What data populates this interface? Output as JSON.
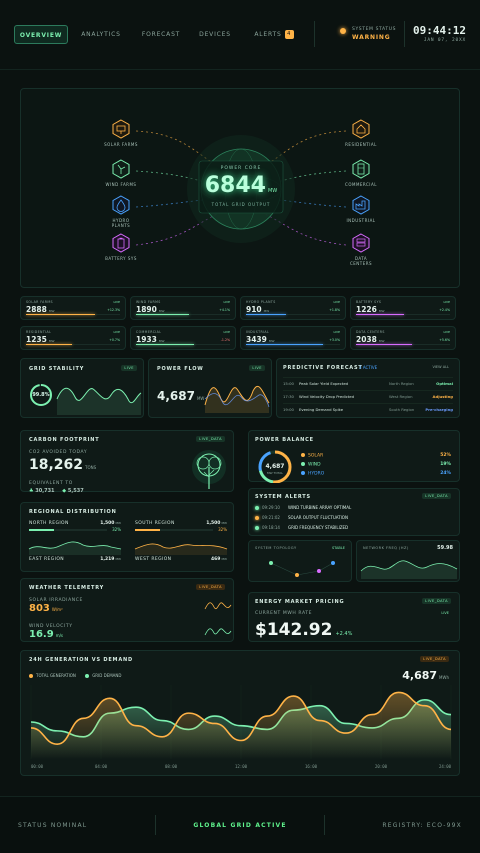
{
  "nav": {
    "tabs": [
      {
        "label": "Overview"
      },
      {
        "label": "Analytics"
      },
      {
        "label": "Forecast"
      },
      {
        "label": "Devices"
      },
      {
        "label": "Alerts"
      }
    ],
    "alerts_count": "4",
    "system_status_label": "SYSTEM STATUS",
    "system_status_value": "WARNING",
    "clock": "09:44:12",
    "date": "JAN 07, 20XX"
  },
  "hero": {
    "core_label": "POWER CORE",
    "core_value": "6844",
    "core_unit": "MW",
    "core_sub": "TOTAL GRID OUTPUT",
    "nodes_left": [
      {
        "label": "SOLAR FARMS",
        "icon": "solar-icon",
        "color": "#ffb347"
      },
      {
        "label": "WIND FARMS",
        "icon": "wind-icon",
        "color": "#7cf0b0"
      },
      {
        "label": "HYDRO PLANTS",
        "icon": "hydro-icon",
        "color": "#4aa3ff"
      },
      {
        "label": "BATTERY SYS",
        "icon": "battery-icon",
        "color": "#d86cff"
      }
    ],
    "nodes_right": [
      {
        "label": "RESIDENTIAL",
        "icon": "home-icon",
        "color": "#ffb347"
      },
      {
        "label": "COMMERCIAL",
        "icon": "building-icon",
        "color": "#7cf0b0"
      },
      {
        "label": "INDUSTRIAL",
        "icon": "factory-icon",
        "color": "#4aa3ff"
      },
      {
        "label": "DATA CENTERS",
        "icon": "server-icon",
        "color": "#d86cff"
      }
    ]
  },
  "stats": [
    {
      "label": "SOLAR FARMS",
      "value": "2888",
      "unit": "MW",
      "delta": "+12.3%",
      "color": "#ffb347",
      "fill": 0.72
    },
    {
      "label": "WIND FARMS",
      "value": "1890",
      "unit": "MW",
      "delta": "+4.1%",
      "color": "#7cf0b0",
      "fill": 0.55
    },
    {
      "label": "HYDRO PLANTS",
      "value": "910",
      "unit": "MW",
      "delta": "+1.8%",
      "color": "#4aa3ff",
      "fill": 0.42
    },
    {
      "label": "BATTERY SYS",
      "value": "1226",
      "unit": "MW",
      "delta": "+2.4%",
      "color": "#d86cff",
      "fill": 0.5
    },
    {
      "label": "RESIDENTIAL",
      "value": "1235",
      "unit": "MW",
      "delta": "+0.7%",
      "color": "#ffb347",
      "fill": 0.48
    },
    {
      "label": "COMMERCIAL",
      "value": "1933",
      "unit": "MW",
      "delta": "-1.2%",
      "color": "#7cf0b0",
      "fill": 0.6
    },
    {
      "label": "INDUSTRIAL",
      "value": "3439",
      "unit": "MW",
      "delta": "+3.0%",
      "color": "#4aa3ff",
      "fill": 0.8
    },
    {
      "label": "DATA CENTERS",
      "value": "2038",
      "unit": "MW",
      "delta": "+5.6%",
      "color": "#d86cff",
      "fill": 0.58
    }
  ],
  "grid_stability": {
    "title": "GRID STABILITY",
    "live": "LIVE",
    "value": "99.8%"
  },
  "power_flow": {
    "title": "POWER FLOW",
    "live": "LIVE",
    "value": "4,687",
    "unit": "MW"
  },
  "forecast": {
    "title": "PREDICTIVE FORECAST",
    "active": "3 ACTIVE",
    "view_all": "VIEW ALL",
    "rows": [
      {
        "time": "15:00",
        "event": "Peak Solar Yield Expected",
        "region": "North Region",
        "status": "Optimal",
        "color": "#7cf0b0"
      },
      {
        "time": "17:30",
        "event": "Wind Velocity Drop Predicted",
        "region": "West Region",
        "status": "Adjusting",
        "color": "#ffb347"
      },
      {
        "time": "19:00",
        "event": "Evening Demand Spike",
        "region": "South Region",
        "status": "Pre-charging",
        "color": "#6c9cff"
      }
    ]
  },
  "carbon": {
    "title": "CARBON FOOTPRINT",
    "live": "LIVE_DATA",
    "avoided_label": "CO2 AVOIDED TODAY",
    "avoided_value": "18,262",
    "avoided_unit": "TONS",
    "equiv_label": "EQUIVALENT TO",
    "equiv_a": "30,731",
    "equiv_b": "5,537"
  },
  "balance": {
    "title": "POWER BALANCE",
    "value": "4,687",
    "sub": "MW TOTAL",
    "items": [
      {
        "label": "SOLAR",
        "pct": "52%",
        "color": "#ffb347",
        "share": 0.52
      },
      {
        "label": "WIND",
        "pct": "19%",
        "color": "#7cf0b0",
        "share": 0.19
      },
      {
        "label": "HYDRO",
        "pct": "24%",
        "color": "#4aa3ff",
        "share": 0.24
      }
    ]
  },
  "regional": {
    "title": "REGIONAL DISTRIBUTION",
    "regions": [
      {
        "name": "NORTH REGION",
        "value": "1,500",
        "unit": "MW",
        "pct": "32%",
        "color": "#7cf0b0",
        "share": 0.32
      },
      {
        "name": "SOUTH REGION",
        "value": "1,500",
        "unit": "MW",
        "pct": "32%",
        "color": "#ffb347",
        "share": 0.32
      },
      {
        "name": "EAST REGION",
        "value": "1,219",
        "unit": "MW",
        "pct": "",
        "color": "#7cf0b0",
        "share": 0
      },
      {
        "name": "WEST REGION",
        "value": "469",
        "unit": "MW",
        "pct": "",
        "color": "#7cf0b0",
        "share": 0
      }
    ]
  },
  "alerts": {
    "title": "SYSTEM ALERTS",
    "live": "LIVE_DATA",
    "items": [
      {
        "time": "09:29:10",
        "text": "WIND TURBINE ARRAY OPTIMAL",
        "color": "#7cf0b0"
      },
      {
        "time": "09:21:02",
        "text": "SOLAR OUTPUT FLUCTUATION",
        "color": "#ffb347"
      },
      {
        "time": "09:18:14",
        "text": "GRID FREQUENCY STABILIZED",
        "color": "#7cf0b0"
      }
    ]
  },
  "topology": {
    "title": "SYSTEM TOPOLOGY",
    "status": "STABLE"
  },
  "network": {
    "title": "NETWORK FREQ (HZ)",
    "value": "59.98"
  },
  "weather": {
    "title": "WEATHER TELEMETRY",
    "live": "LIVE_DATA",
    "irr_label": "SOLAR IRRADIANCE",
    "irr_value": "803",
    "irr_unit": "W/m²",
    "wind_label": "WIND VELOCITY",
    "wind_value": "16.9",
    "wind_unit": "m/s"
  },
  "market": {
    "title": "ENERGY MARKET PRICING",
    "live": "LIVE_DATA",
    "rate_label": "CURRENT MWH RATE",
    "rate_live": "LIVE",
    "price": "$142.92",
    "delta": "+2.4%"
  },
  "gen_chart": {
    "title": "24H GENERATION VS DEMAND",
    "live": "LIVE_DATA",
    "value": "4,687",
    "unit": "MWh",
    "legend": [
      {
        "label": "TOTAL GENERATION",
        "color": "#ffb347"
      },
      {
        "label": "GRID DEMAND",
        "color": "#7cf0b0"
      }
    ]
  },
  "chart_data": {
    "type": "area",
    "title": "24H GENERATION VS DEMAND",
    "x": [
      "00:00",
      "04:00",
      "08:00",
      "12:00",
      "16:00",
      "20:00",
      "24:00"
    ],
    "series": [
      {
        "name": "TOTAL GENERATION",
        "values": [
          42,
          20,
          55,
          82,
          45,
          30,
          62,
          48,
          25,
          58,
          85,
          52,
          35,
          60,
          90,
          72,
          40
        ]
      },
      {
        "name": "GRID DEMAND",
        "values": [
          50,
          38,
          30,
          62,
          70,
          52,
          40,
          58,
          45,
          40,
          66,
          72,
          48,
          42,
          55,
          80,
          60
        ]
      }
    ],
    "ylim": [
      0,
      100
    ],
    "grid": true
  },
  "footer": {
    "left": "STATUS NOMINAL",
    "center": "GLOBAL GRID ACTIVE",
    "right": "REGISTRY: ECO-99X"
  }
}
